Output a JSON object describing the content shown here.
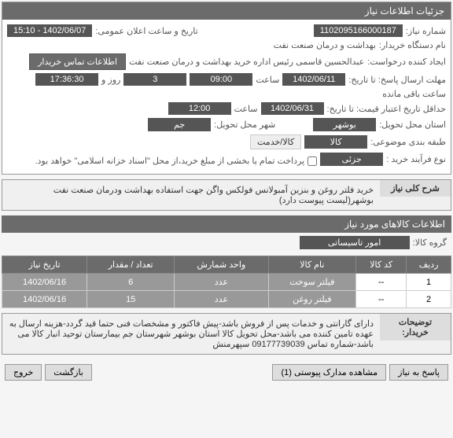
{
  "header": "جزئیات اطلاعات نیاز",
  "fields": {
    "need_no_label": "شماره نیاز:",
    "need_no": "1102095166000187",
    "announce_label": "تاریخ و ساعت اعلان عمومی:",
    "announce": "1402/06/07 - 15:10",
    "buyer_dev_label": "نام دستگاه خریدار:",
    "buyer_dev": "بهداشت و درمان صنعت نفت",
    "creator_label": "ایجاد کننده درخواست:",
    "creator": "عبدالحسین قاسمی رئیس اداره خرید  بهداشت و درمان صنعت نفت",
    "contact_btn": "اطلاعات تماس خریدار",
    "deadline_label": "مهلت ارسال پاسخ: تا تاریخ:",
    "deadline_date": "1402/06/11",
    "time_label": "ساعت",
    "deadline_time": "09:00",
    "days_label": "روز و",
    "days": "3",
    "remain_time": "17:36:30",
    "remain_label": "ساعت باقی مانده",
    "min_valid_label": "حداقل تاریخ اعتبار قیمت: تا تاریخ:",
    "min_valid_date": "1402/06/31",
    "min_valid_time": "12:00",
    "deliver_prov_label": "استان محل تحویل:",
    "deliver_prov": "بوشهر",
    "deliver_city_label": "شهر محل تحویل:",
    "deliver_city": "جم",
    "category_label": "طبقه بندی موضوعی:",
    "cat_goods": "کالا",
    "cat_service": "کالا/خدمت",
    "process_label": "نوع فرآیند خرید :",
    "process": "جزئی",
    "payment_note": "پرداخت تمام یا بخشی از مبلغ خرید،از محل \"اسناد خزانه اسلامی\" خواهد بود."
  },
  "desc": {
    "label": "شرح کلی نیاز",
    "text": "خرید فلتر روغن و  بنزین آمبولانس فولکس واگن جهت استفاده بهداشت ودرمان صنعت نفت بوشهر(لیست پیوست دارد)"
  },
  "items_header": "اطلاعات کالاهای مورد نیاز",
  "group_label": "گروه کالا:",
  "group_value": "امور تاسیساتی",
  "table": {
    "headers": [
      "ردیف",
      "کد کالا",
      "نام کالا",
      "واحد شمارش",
      "تعداد / مقدار",
      "تاریخ نیاز"
    ],
    "rows": [
      [
        "1",
        "--",
        "فیلتر سوخت",
        "عدد",
        "6",
        "1402/06/16"
      ],
      [
        "2",
        "--",
        "فیلتر روغن",
        "عدد",
        "15",
        "1402/06/16"
      ]
    ]
  },
  "notes": {
    "label": "توضیحات خریدار:",
    "text": "دارای گارانتی و خدمات پس از فروش باشد-پیش فاکتور و مشخصات فنی حتما قید گردد-هزینه ارسال به عهده تامین کننده می باشد-محل تحویل کالا استان بوشهر شهرستان جم بیمارستان توحید انبار کالا می باشد-شماره تماس 09177739039 سپهرمنش"
  },
  "footer": {
    "reply": "پاسخ به نیاز",
    "attach": "مشاهده مدارک پیوستی (1)",
    "back": "بازگشت",
    "exit": "خروج"
  }
}
